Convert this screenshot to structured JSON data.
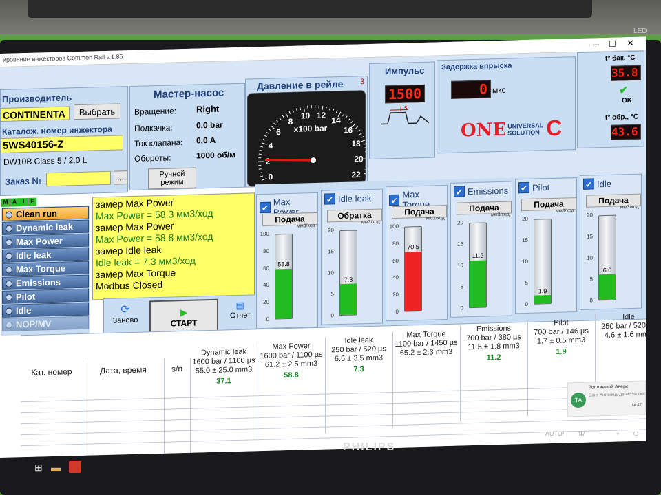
{
  "window": {
    "title": "ирование инжекторов Common Rail v.1.85",
    "led_label": "LED",
    "brand": "PHILIPS"
  },
  "manufacturer": {
    "label": "Производитель",
    "value": "CONTINENTA",
    "select_button": "Выбрать"
  },
  "catalog": {
    "label": "Каталож. номер инжектора",
    "value": "5WS40156-Z",
    "spec": "DW10B Class 5 / 2.0 L"
  },
  "order": {
    "label": "Заказ №",
    "value": "",
    "more_button": "..."
  },
  "maif": [
    "M",
    "A",
    "I",
    "F"
  ],
  "master_pump": {
    "title": "Мастер-насос",
    "rows": [
      {
        "label": "Вращение:",
        "value": "Right"
      },
      {
        "label": "Подкачка:",
        "value": "0.0 bar"
      },
      {
        "label": "Ток клапана:",
        "value": "0.0 A"
      },
      {
        "label": "Обороты:",
        "value": "1000 об/м"
      }
    ],
    "manual_mode": "Ручной режим"
  },
  "pressure": {
    "title": "Давление в рейле",
    "unit": "x100 bar",
    "ticks": [
      "0",
      "2",
      "4",
      "6",
      "8",
      "10",
      "12",
      "14",
      "16",
      "18",
      "20",
      "22"
    ],
    "corner": "3",
    "needle_value": 2.2
  },
  "impulse": {
    "title": "Импульс",
    "value": "1500",
    "unit": "µs"
  },
  "delay": {
    "title": "Задержка впрыска",
    "value": "0",
    "unit": "мкс"
  },
  "logo": {
    "one": "ONE",
    "line1": "UNIVERSAL",
    "line2": "SOLUTION",
    "accent": "#e3202a"
  },
  "temps": [
    {
      "label": "t° бак, °C",
      "value": "35.8",
      "status": "OK"
    },
    {
      "label": "t° обр., °C",
      "value": "43.6"
    }
  ],
  "sequence": {
    "items": [
      {
        "label": "Clean run",
        "active": true
      },
      {
        "label": "Dynamic leak"
      },
      {
        "label": "Max Power"
      },
      {
        "label": "Idle leak"
      },
      {
        "label": "Max Torque"
      },
      {
        "label": "Emissions"
      },
      {
        "label": "Pilot"
      },
      {
        "label": "Idle"
      },
      {
        "label": "NOP/MV",
        "disabled": true
      }
    ]
  },
  "log": [
    {
      "text": "замер Max Power",
      "kind": "info"
    },
    {
      "text": "Max Power = 58.3 мм3/ход",
      "kind": "result"
    },
    {
      "text": "замер Max Power",
      "kind": "info"
    },
    {
      "text": "Max Power = 58.8 мм3/ход",
      "kind": "result"
    },
    {
      "text": "замер Idle leak",
      "kind": "info"
    },
    {
      "text": "Idle leak = 7.3 мм3/ход",
      "kind": "result"
    },
    {
      "text": "замер Max Torque",
      "kind": "info"
    },
    {
      "text": "Modbus Closed",
      "kind": "info"
    }
  ],
  "actions": {
    "restart": "Заново",
    "start": "СТАРТ",
    "report": "Отчет"
  },
  "tubes": [
    {
      "name": "Max Power",
      "mode": "Подача",
      "unit": "мм3/ход",
      "max": 100,
      "ticks": [
        "100",
        "80",
        "60",
        "40",
        "20",
        "0"
      ],
      "value": 58.8,
      "label": "58.8",
      "color": "#22bb22"
    },
    {
      "name": "Idle leak",
      "mode": "Обратка",
      "unit": "мм3/ход",
      "max": 20,
      "ticks": [
        "20",
        "15",
        "10",
        "5",
        "0"
      ],
      "value": 7.3,
      "label": "7.3",
      "color": "#22bb22"
    },
    {
      "name": "Max Torque",
      "mode": "Подача",
      "unit": "мм3/ход",
      "max": 100,
      "ticks": [
        "100",
        "80",
        "60",
        "40",
        "20",
        "0"
      ],
      "value": 70.5,
      "label": "70.5",
      "color": "#ee2222"
    },
    {
      "name": "Emissions",
      "mode": "Подача",
      "unit": "мм3/ход",
      "max": 20,
      "ticks": [
        "20",
        "15",
        "10",
        "5",
        "0"
      ],
      "value": 11.2,
      "label": "11.2",
      "color": "#22bb22"
    },
    {
      "name": "Pilot",
      "mode": "Подача",
      "unit": "мм3/ход",
      "max": 20,
      "ticks": [
        "20",
        "15",
        "10",
        "5",
        "0"
      ],
      "value": 1.9,
      "label": "1.9",
      "color": "#22bb22"
    },
    {
      "name": "Idle",
      "mode": "Подача",
      "unit": "мм3/ход",
      "max": 20,
      "ticks": [
        "20",
        "15",
        "10",
        "5",
        "0"
      ],
      "value": 6.0,
      "label": "6.0",
      "color": "#22bb22"
    }
  ],
  "table": {
    "fixed_headers": [
      "Кат. номер",
      "Дата, время",
      "s/n"
    ],
    "tests": [
      {
        "name": "Dynamic leak",
        "params": "1600 bar / 1100 µs",
        "nominal": "55.0 ± 25.0 mm3",
        "result": "37.1"
      },
      {
        "name": "Max Power",
        "params": "1600 bar / 1100 µs",
        "nominal": "61.2 ± 2.5 mm3",
        "result": "58.8"
      },
      {
        "name": "Idle leak",
        "params": "250 bar / 520 µs",
        "nominal": "6.5 ± 3.5 mm3",
        "result": "7.3"
      },
      {
        "name": "Max Torque",
        "params": "1100 bar / 1450 µs",
        "nominal": "65.2 ± 2.3 mm3",
        "result": ""
      },
      {
        "name": "Emissions",
        "params": "700 bar / 380 µs",
        "nominal": "11.5 ± 1.8 mm3",
        "result": "11.2"
      },
      {
        "name": "Pilot",
        "params": "700 bar / 146 µs",
        "nominal": "1.7 ± 0.5 mm3",
        "result": "1.9"
      },
      {
        "name": "Idle",
        "params": "250 bar / 520 µs",
        "nominal": "4.6 ± 1.6 mm3",
        "result": ""
      }
    ]
  },
  "notification": {
    "avatar": "TA",
    "title": "Топливный Аверс",
    "body": "Саня Антонець Денис уж сказал...",
    "time": "14:47",
    "date": "16.06.2022",
    "lang": "ENG"
  },
  "monitor_buttons": [
    "AUTO/",
    "⇅/",
    "−",
    "+",
    "⏻"
  ]
}
